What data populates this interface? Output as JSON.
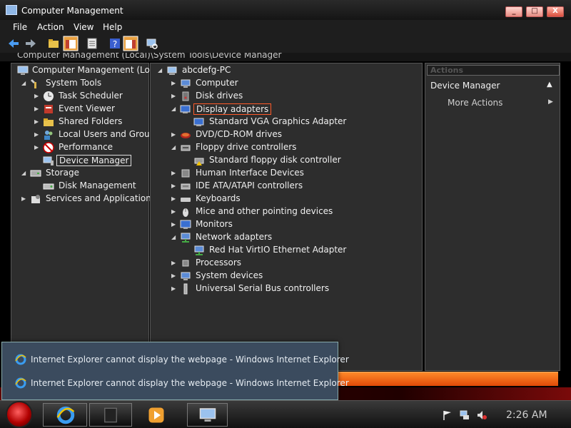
{
  "window": {
    "title": "Computer Management",
    "minimize": "_",
    "maximize": "□",
    "close": "X"
  },
  "menu": [
    "File",
    "Action",
    "View",
    "Help"
  ],
  "path": "Computer Management (Local)\\System Tools\\Device Manager",
  "left_tree": [
    {
      "label": "Computer Management (Local",
      "icon": "computer-management-icon",
      "expander": ""
    },
    {
      "label": "System Tools",
      "icon": "system-tools-icon",
      "expander": "◢"
    },
    {
      "label": "Task Scheduler",
      "icon": "task-scheduler-icon",
      "expander": "▶"
    },
    {
      "label": "Event Viewer",
      "icon": "event-viewer-icon",
      "expander": "▶"
    },
    {
      "label": "Shared Folders",
      "icon": "shared-folders-icon",
      "expander": "▶"
    },
    {
      "label": "Local Users and Groups",
      "icon": "users-icon",
      "expander": "▶"
    },
    {
      "label": "Performance",
      "icon": "performance-icon",
      "expander": "▶"
    },
    {
      "label": "Device Manager",
      "icon": "device-manager-icon",
      "expander": ""
    },
    {
      "label": "Storage",
      "icon": "storage-icon",
      "expander": "◢"
    },
    {
      "label": "Disk Management",
      "icon": "disk-management-icon",
      "expander": ""
    },
    {
      "label": "Services and Applications",
      "icon": "services-icon",
      "expander": "▶"
    }
  ],
  "device_tree": [
    {
      "label": "abcdefg-PC",
      "icon": "pc-icon",
      "expander": "◢"
    },
    {
      "label": "Computer",
      "icon": "computer-icon",
      "expander": "▶"
    },
    {
      "label": "Disk drives",
      "icon": "disk-drive-icon",
      "expander": "▶"
    },
    {
      "label": "Display adapters",
      "icon": "display-adapter-icon",
      "expander": "◢"
    },
    {
      "label": "Standard VGA Graphics Adapter",
      "icon": "display-adapter-icon",
      "expander": ""
    },
    {
      "label": "DVD/CD-ROM drives",
      "icon": "dvd-icon",
      "expander": "▶"
    },
    {
      "label": "Floppy drive controllers",
      "icon": "floppy-controller-icon",
      "expander": "◢"
    },
    {
      "label": "Standard floppy disk controller",
      "icon": "floppy-controller-icon",
      "expander": ""
    },
    {
      "label": "Human Interface Devices",
      "icon": "hid-icon",
      "expander": "▶"
    },
    {
      "label": "IDE ATA/ATAPI controllers",
      "icon": "ide-icon",
      "expander": "▶"
    },
    {
      "label": "Keyboards",
      "icon": "keyboard-icon",
      "expander": "▶"
    },
    {
      "label": "Mice and other pointing devices",
      "icon": "mouse-icon",
      "expander": "▶"
    },
    {
      "label": "Monitors",
      "icon": "monitor-icon",
      "expander": "▶"
    },
    {
      "label": "Network adapters",
      "icon": "network-adapter-icon",
      "expander": "◢"
    },
    {
      "label": "Red Hat VirtIO Ethernet Adapter",
      "icon": "network-adapter-icon",
      "expander": ""
    },
    {
      "label": "Processors",
      "icon": "processor-icon",
      "expander": "▶"
    },
    {
      "label": "System devices",
      "icon": "system-devices-icon",
      "expander": "▶"
    },
    {
      "label": "Universal Serial Bus controllers",
      "icon": "usb-icon",
      "expander": "▶"
    }
  ],
  "actions": {
    "header": "Actions",
    "section": "Device Manager",
    "more": "More Actions",
    "collapse_glyph": "▲",
    "more_glyph": "▶"
  },
  "popup_items": [
    "Internet Explorer cannot display the webpage - Windows Internet Explorer",
    "Internet Explorer cannot display the webpage - Windows Internet Explorer"
  ],
  "clock": "2:26 AM",
  "colors": {
    "accent": "#ff5a2a",
    "orange": "#e14a08",
    "panel": "#2d2d2d"
  }
}
